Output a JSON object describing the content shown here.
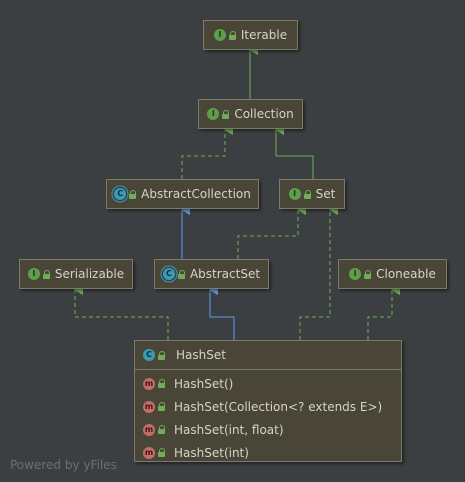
{
  "nodes": {
    "iterable": {
      "label": "Iterable",
      "badge": "I"
    },
    "collection": {
      "label": "Collection",
      "badge": "I"
    },
    "abstract_collection": {
      "label": "AbstractCollection",
      "badge": "C"
    },
    "set": {
      "label": "Set",
      "badge": "I"
    },
    "serializable": {
      "label": "Serializable",
      "badge": "I"
    },
    "abstract_set": {
      "label": "AbstractSet",
      "badge": "C"
    },
    "cloneable": {
      "label": "Cloneable",
      "badge": "I"
    }
  },
  "hashset": {
    "title": "HashSet",
    "badge": "C",
    "methods": [
      {
        "badge": "m",
        "label": "HashSet()"
      },
      {
        "badge": "m",
        "label": "HashSet(Collection<? extends E>)"
      },
      {
        "badge": "m",
        "label": "HashSet(int, float)"
      },
      {
        "badge": "m",
        "label": "HashSet(int)"
      }
    ]
  },
  "footer": "Powered by yFiles",
  "colors": {
    "background": "#3c3f41",
    "interface_edge": "#5f9d4c",
    "extends_edge": "#5c9eea",
    "node_fill": "#4a4637"
  }
}
